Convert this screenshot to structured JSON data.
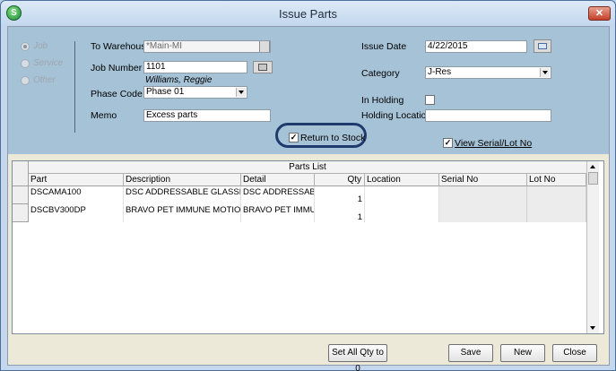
{
  "window": {
    "title": "Issue Parts",
    "app_icon": "S"
  },
  "source_type": {
    "options": [
      "Job",
      "Service",
      "Other"
    ],
    "selected": "Job"
  },
  "form": {
    "to_warehouse_label": "To Warehouse",
    "to_warehouse_value": "*Main-MI",
    "job_number_label": "Job Number",
    "job_number_value": "1101",
    "job_customer": "Williams, Reggie",
    "phase_code_label": "Phase Code",
    "phase_code_value": "Phase 01",
    "memo_label": "Memo",
    "memo_value": "Excess parts",
    "issue_date_label": "Issue Date",
    "issue_date_value": "4/22/2015",
    "category_label": "Category",
    "category_value": "J-Res",
    "in_holding_label": "In Holding",
    "in_holding_checked": false,
    "holding_location_label": "Holding Location",
    "holding_location_value": "",
    "return_to_stock_label": "Return to Stock",
    "return_to_stock_checked": true,
    "view_serial_label": "View Serial/Lot No",
    "view_serial_checked": true
  },
  "parts_list": {
    "caption": "Parts List",
    "columns": [
      "Part",
      "Description",
      "Detail",
      "Qty",
      "Location",
      "Serial No",
      "Lot No"
    ],
    "rows": [
      {
        "part": "DSCAMA100",
        "description": "DSC ADDRESSABLE GLASSBREAK",
        "detail": "DSC ADDRESSABLE G",
        "qty": "1",
        "location": "",
        "serial": "",
        "lot": ""
      },
      {
        "part": "DSCBV300DP",
        "description": "BRAVO PET IMMUNE MOTION",
        "detail": "BRAVO PET IMMUNE",
        "qty": "1",
        "location": "",
        "serial": "",
        "lot": ""
      }
    ]
  },
  "buttons": {
    "set_all_qty": "Set All Qty to 0",
    "save": "Save",
    "new": "New",
    "close": "Close"
  },
  "colors": {
    "header_panel": "#a6c2d6",
    "highlight_ring": "#1f3b6e",
    "title_bar": "#c3d7ee"
  }
}
